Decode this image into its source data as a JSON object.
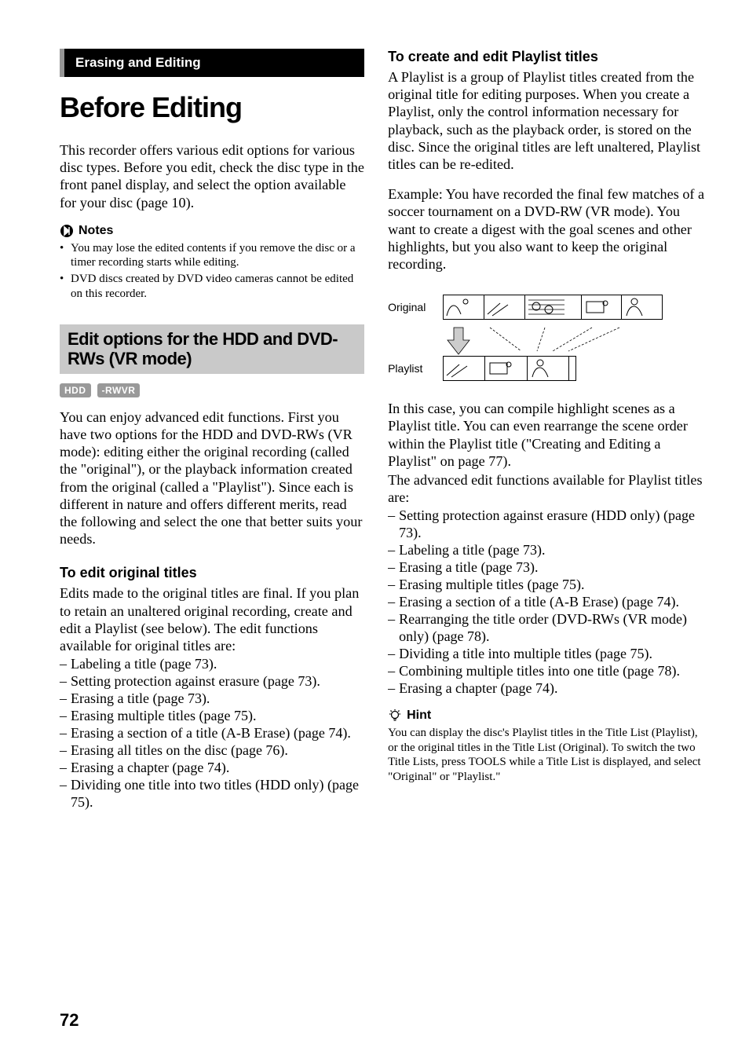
{
  "left": {
    "banner": "Erasing and Editing",
    "main_title": "Before Editing",
    "intro": "This recorder offers various edit options for various disc types. Before you edit, check the disc type in the front panel display, and select the option available for your disc (page 10).",
    "notes_label": "Notes",
    "notes": [
      "You may lose the edited contents if you remove the disc or a timer recording starts while editing.",
      "DVD discs created by DVD video cameras cannot be edited on this recorder."
    ],
    "sub_header": "Edit options for the HDD and DVD-RWs (VR mode)",
    "badge_hdd": "HDD",
    "badge_rwvr": "-RWVR",
    "advanced_text": "You can enjoy advanced edit functions. First you have two options for the HDD and DVD-RWs (VR mode): editing either the original recording (called the \"original\"), or the playback information created from the original (called a \"Playlist\"). Since each is different in nature and offers different merits, read the following and select the one that better suits your needs.",
    "edit_orig_title": "To edit original titles",
    "edit_orig_text": "Edits made to the original titles are final. If you plan to retain an unaltered original recording, create and edit a Playlist (see below). The edit functions available for original titles are:",
    "orig_fns": [
      "Labeling a title (page 73).",
      "Setting protection against erasure (page 73).",
      "Erasing a title (page 73).",
      "Erasing multiple titles (page 75).",
      "Erasing a section of a title (A-B Erase) (page 74).",
      "Erasing all titles on the disc (page 76).",
      "Erasing a chapter (page 74).",
      "Dividing one title into two titles (HDD only) (page 75)."
    ]
  },
  "right": {
    "playlist_title": "To create and edit Playlist titles",
    "playlist_p1": "A Playlist is a group of Playlist titles created from the original title for editing purposes. When you create a Playlist, only the control information necessary for playback, such as the playback order, is stored on the disc. Since the original titles are left unaltered, Playlist titles can be re-edited.",
    "playlist_p2": "Example: You have recorded the final few matches of a soccer tournament on a DVD-RW (VR mode). You want to create a digest with the goal scenes and other highlights, but you also want to keep the original recording.",
    "diag_original": "Original",
    "diag_playlist": "Playlist",
    "playlist_p3": "In this case, you can compile highlight scenes as a Playlist title. You can even rearrange the scene order within the Playlist title (\"Creating and Editing a Playlist\" on page 77).",
    "playlist_p4": "The advanced edit functions available for Playlist titles are:",
    "playlist_fns": [
      "Setting protection against erasure (HDD only) (page 73).",
      "Labeling a title (page 73).",
      "Erasing a title (page 73).",
      "Erasing multiple titles (page 75).",
      "Erasing a section of a title (A-B Erase) (page 74).",
      "Rearranging the title order (DVD-RWs (VR mode) only) (page 78).",
      "Dividing a title into multiple titles (page 75).",
      "Combining multiple titles into one title (page 78).",
      "Erasing a chapter (page 74)."
    ],
    "hint_label": "Hint",
    "hint_text": "You can display the disc's Playlist titles in the Title List (Playlist), or the original titles in the Title List (Original). To switch the two Title Lists, press TOOLS while a Title List is displayed, and select \"Original\" or \"Playlist.\""
  },
  "page_number": "72"
}
